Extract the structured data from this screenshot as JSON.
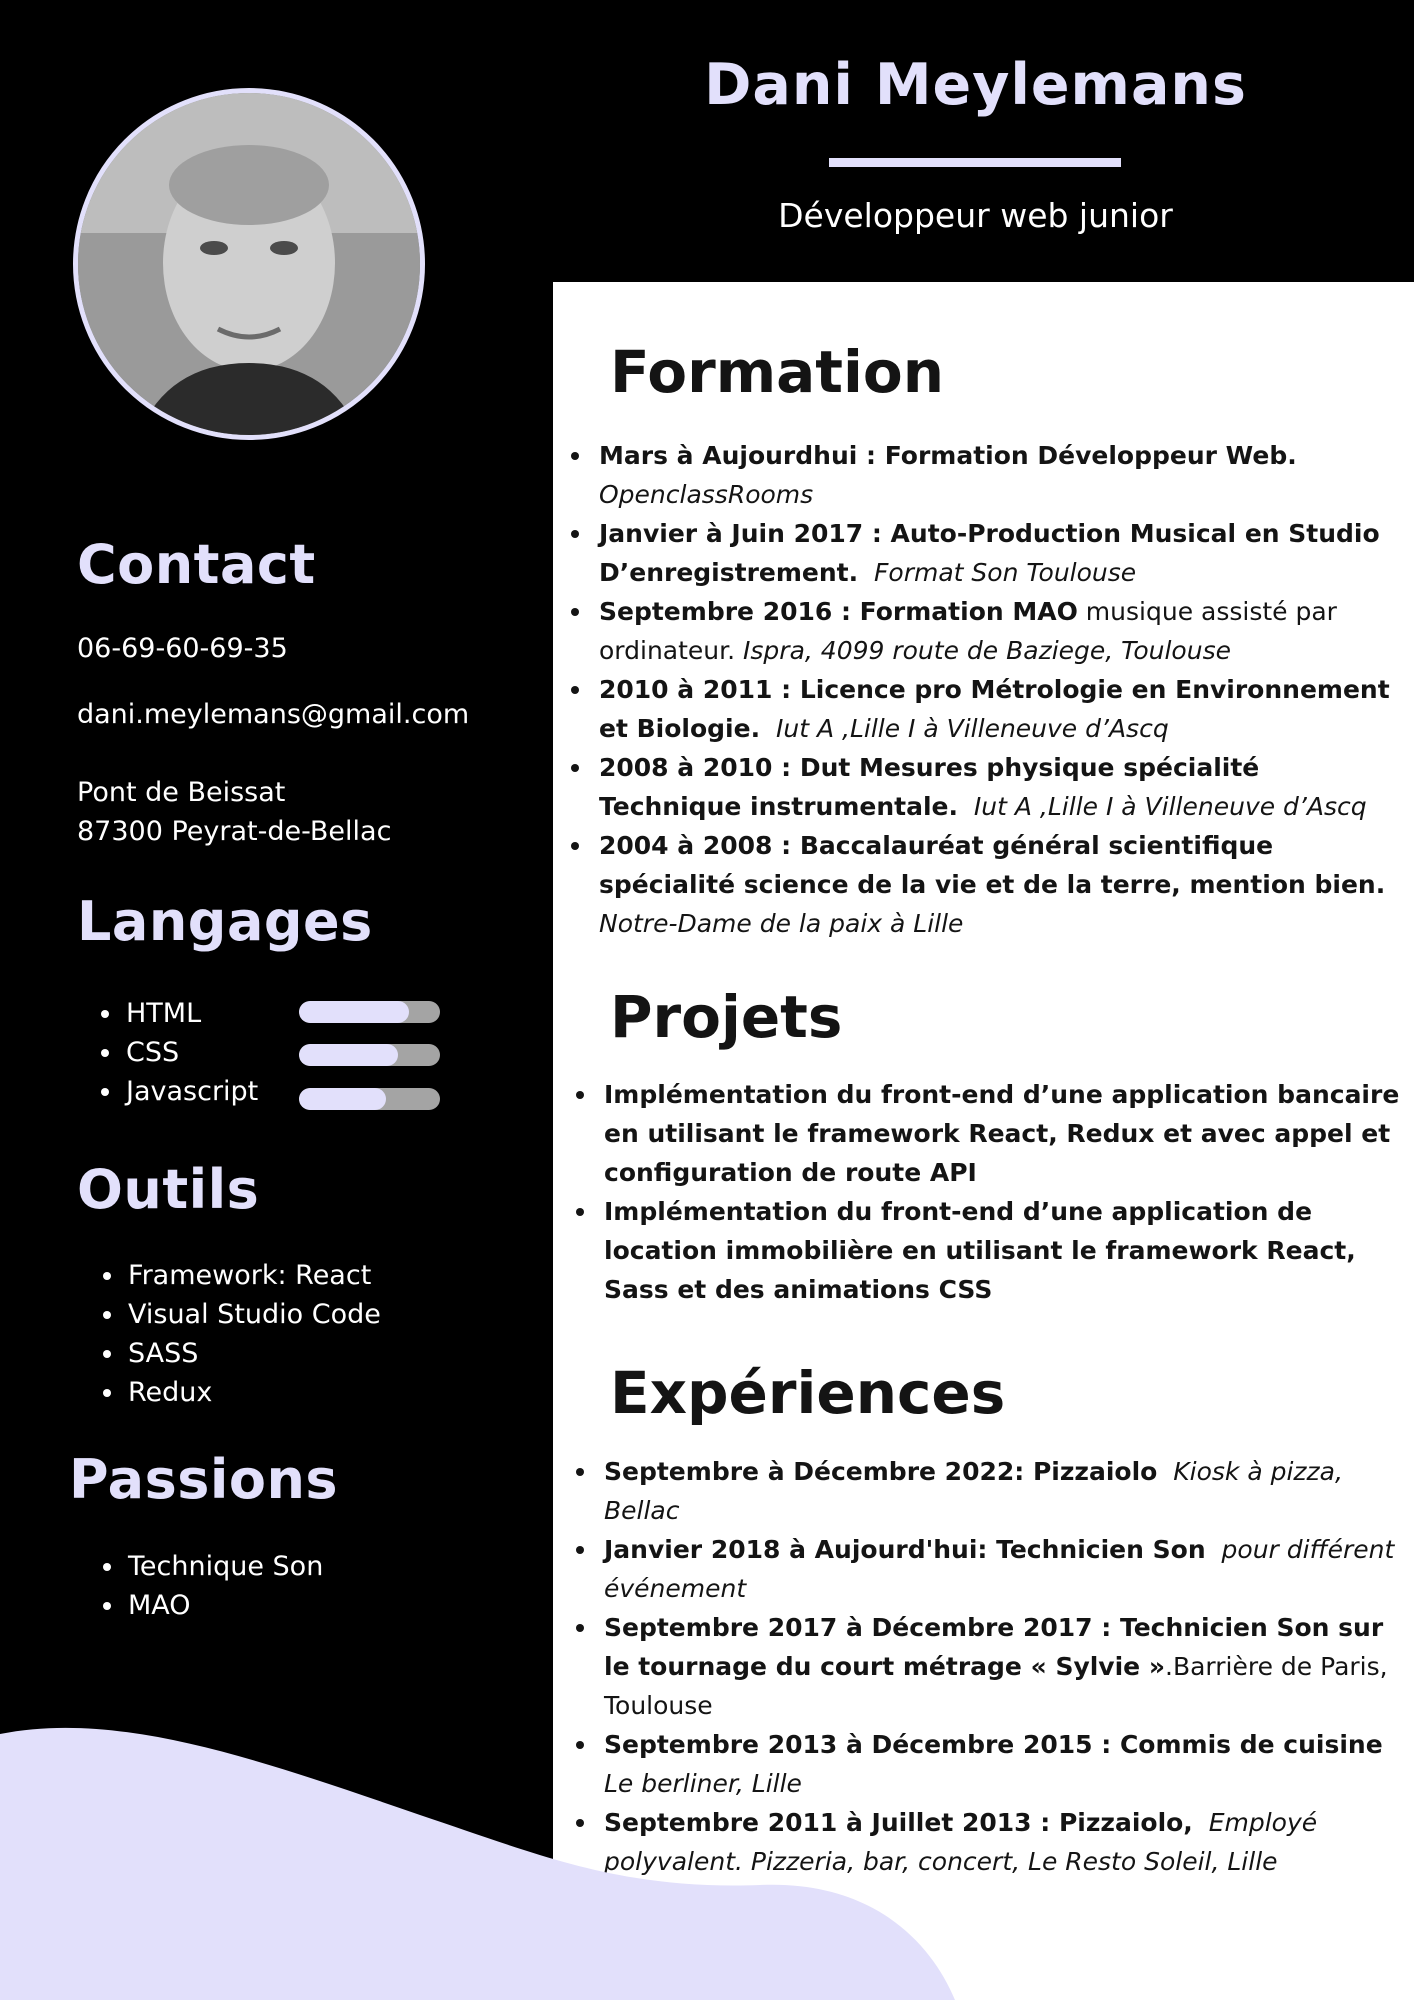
{
  "header": {
    "name": "Dani Meylemans",
    "job_title": "Développeur web junior"
  },
  "photo": {
    "alt": "profile-photo"
  },
  "contact": {
    "heading": "Contact",
    "phone": "06-69-60-69-35",
    "email": "dani.meylemans@gmail.com",
    "address_line1": "Pont de Beissat",
    "address_line2": "87300 Peyrat-de-Bellac"
  },
  "langages": {
    "heading": "Langages",
    "items": [
      {
        "label": "HTML",
        "level": 0.78
      },
      {
        "label": "CSS",
        "level": 0.7
      },
      {
        "label": "Javascript",
        "level": 0.62
      }
    ]
  },
  "outils": {
    "heading": "Outils",
    "items": [
      "Framework: React",
      "Visual Studio Code",
      "SASS",
      "Redux"
    ]
  },
  "passions": {
    "heading": "Passions",
    "items": [
      "Technique Son",
      "MAO"
    ]
  },
  "formation": {
    "heading": "Formation",
    "items": [
      {
        "bold": "Mars à Aujourdhui : Formation Développeur Web.",
        "normal": "",
        "italic": "OpenclassRooms",
        "break_before_italic": true
      },
      {
        "bold": "Janvier à Juin 2017 : Auto-Production Musical en Studio D’enregistrement.",
        "normal": "",
        "italic": "Format Son Toulouse"
      },
      {
        "bold": "Septembre 2016 : Formation MAO",
        "normal": " musique assisté par ordinateur. ",
        "italic": "Ispra, 4099 route de Baziege, Toulouse"
      },
      {
        "bold": "2010 à 2011 : Licence pro Métrologie en Environnement et Biologie.",
        "normal": "",
        "italic": "Iut A ,Lille I à Villeneuve d’Ascq"
      },
      {
        "bold": "2008 à 2010 : Dut Mesures physique spécialité Technique instrumentale.",
        "normal": "",
        "italic": "Iut A ,Lille I à Villeneuve d’Ascq"
      },
      {
        "bold": "2004 à 2008 : Baccalauréat général scientifique spécialité science de la vie et de la terre, mention bien.",
        "normal": "",
        "italic": "Notre-Dame de la paix à Lille",
        "break_before_italic": true
      }
    ]
  },
  "projets": {
    "heading": "Projets",
    "items": [
      "Implémentation du front-end d’une application bancaire en utilisant le framework React, Redux et avec appel et configuration de route API",
      "Implémentation du front-end d’une application de location immobilière en utilisant le framework React, Sass et des animations CSS"
    ]
  },
  "experiences": {
    "heading": "Expériences",
    "items": [
      {
        "bold": "Septembre à Décembre 2022: Pizzaiolo",
        "normal": "",
        "italic": "Kiosk à pizza, Bellac"
      },
      {
        "bold": "Janvier 2018 à Aujourd'hui: Technicien Son",
        "normal": "",
        "italic": "pour différent événement"
      },
      {
        "bold": "Septembre 2017 à Décembre 2017 : Technicien Son sur le tournage du court métrage « Sylvie »",
        "normal": ".Barrière de Paris, Toulouse",
        "italic": ""
      },
      {
        "bold": "Septembre 2013 à Décembre 2015 : Commis de cuisine",
        "normal": "",
        "italic": "Le berliner, Lille"
      },
      {
        "bold": "Septembre 2011 à Juillet 2013 : Pizzaiolo,",
        "normal": "",
        "italic": "Employé polyvalent. Pizzeria, bar, concert, Le Resto Soleil, Lille"
      }
    ]
  },
  "colors": {
    "sidebar_bg": "#000000",
    "accent_lavender": "#e2e0fb",
    "wave": "#e2e0fb",
    "bar_track": "#a4a4a4",
    "text_dark": "#141414"
  }
}
